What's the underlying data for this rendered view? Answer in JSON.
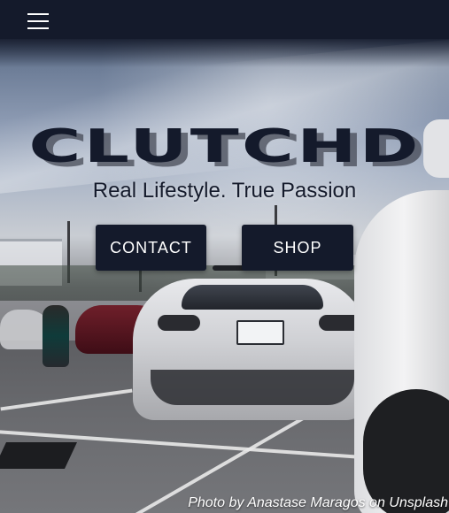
{
  "header": {
    "menu_icon": "hamburger-menu-icon",
    "background_color": "#141a2b"
  },
  "hero": {
    "logo_text": "CLUTCHD",
    "tagline": "Real Lifestyle. True Passion",
    "buttons": {
      "contact_label": "CONTACT",
      "shop_label": "SHOP"
    },
    "accent_color": "#141a2b"
  },
  "credit": {
    "prefix": "Photo by ",
    "photographer": "Anastase Maragos",
    "middle": " on ",
    "site": "Unsplash"
  }
}
